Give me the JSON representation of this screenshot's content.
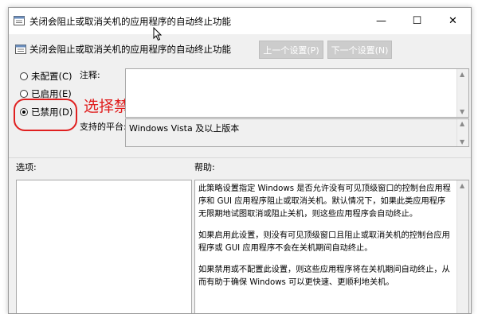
{
  "window": {
    "title": "关闭会阻止或取消关机的应用程序的自动终止功能",
    "minimize_glyph": "—",
    "maximize_glyph": "☐",
    "close_glyph": "✕"
  },
  "header": {
    "policy_title": "关闭会阻止或取消关机的应用程序的自动终止功能",
    "prev_button": "上一个设置(P)",
    "next_button": "下一个设置(N)"
  },
  "options": {
    "not_configured": "未配置(C)",
    "enabled": "已启用(E)",
    "disabled": "已禁用(D)",
    "selected": "disabled"
  },
  "annotation": "选择禁止，加快关机速度",
  "fields": {
    "comment_label": "注释:",
    "comment_value": "",
    "platform_label": "支持的平台:",
    "platform_value": "Windows Vista 及以上版本"
  },
  "sections": {
    "options_label": "选项:",
    "help_label": "帮助:"
  },
  "help": {
    "paragraphs": [
      "此策略设置指定 Windows 是否允许没有可见顶级窗口的控制台应用程序和 GUI 应用程序阻止或取消关机。默认情况下，如果此类应用程序无限期地试图取消或阻止关机，则这些应用程序会自动终止。",
      "如果启用此设置，则没有可见顶级窗口且阻止或取消关机的控制台应用程序或 GUI 应用程序不会在关机期间自动终止。",
      "如果禁用或不配置此设置，则这些应用程序将在关机期间自动终止，从而有助于确保 Windows 可以更快速、更顺利地关机。"
    ]
  },
  "colors": {
    "annotation": "#e01b1b",
    "window_bg": "#f0f0f0"
  }
}
